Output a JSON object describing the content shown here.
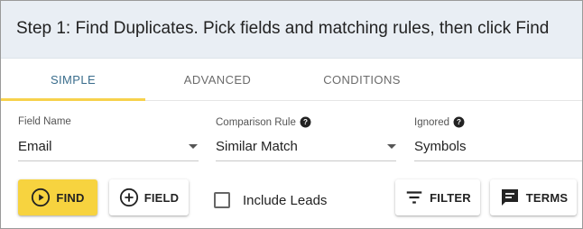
{
  "header": {
    "title": "Step 1: Find Duplicates. Pick fields and matching rules, then click Find"
  },
  "tabs": [
    {
      "label": "SIMPLE",
      "active": true
    },
    {
      "label": "ADVANCED",
      "active": false
    },
    {
      "label": "CONDITIONS",
      "active": false
    }
  ],
  "fields": {
    "field_name": {
      "label": "Field Name",
      "value": "Email"
    },
    "comparison_rule": {
      "label": "Comparison Rule",
      "value": "Similar Match"
    },
    "ignored": {
      "label": "Ignored",
      "value": "Symbols"
    }
  },
  "actions": {
    "find_label": "FIND",
    "field_label": "FIELD",
    "include_leads_label": "Include Leads",
    "include_leads_checked": false,
    "filter_label": "FILTER",
    "terms_label": "TERMS"
  },
  "colors": {
    "accent_yellow": "#f7d33f",
    "header_bg": "#e9eef4",
    "active_tab_text": "#3a6d8c"
  },
  "icons": {
    "find": "play-circle-icon",
    "field": "add-circle-icon",
    "filter": "filter-list-icon",
    "terms": "chat-box-icon",
    "help": "help-circle-icon",
    "dropdown": "caret-down-icon"
  }
}
